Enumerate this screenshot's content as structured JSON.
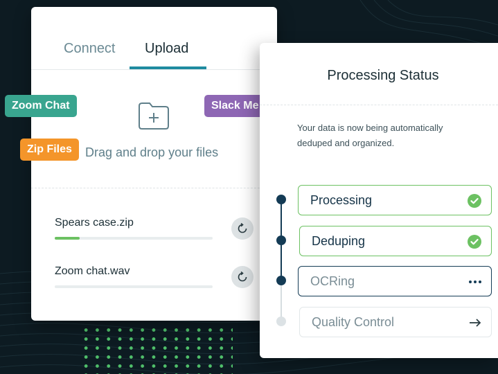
{
  "upload_panel": {
    "tabs": [
      {
        "label": "Connect",
        "active": false
      },
      {
        "label": "Upload",
        "active": true
      }
    ],
    "drop_text": "Drag and drop your files",
    "files": [
      {
        "name": "Spears case.zip",
        "progress": 0.16
      },
      {
        "name": "Zoom chat.wav",
        "progress": 0
      }
    ]
  },
  "tags": {
    "zoom_chat": "Zoom Chat",
    "zip_files": "Zip Files",
    "slack": "Slack Me"
  },
  "processing_panel": {
    "title": "Processing Status",
    "description": "Your data is now being automatically deduped and organized.",
    "steps": [
      {
        "label": "Processing",
        "status": "done",
        "icon": "check-icon"
      },
      {
        "label": "Deduping",
        "status": "done",
        "icon": "check-icon"
      },
      {
        "label": "OCRing",
        "status": "in-progress",
        "icon": "more-icon"
      },
      {
        "label": "Quality Control",
        "status": "pending",
        "icon": "arrow-right-icon"
      }
    ]
  },
  "colors": {
    "background": "#0d1b22",
    "accent_teal": "#1f8ba0",
    "success_green": "#6cc162",
    "navy": "#143b55",
    "tag_zoom": "#39a58f",
    "tag_zip": "#f4952a",
    "tag_slack": "#8e67b4"
  }
}
